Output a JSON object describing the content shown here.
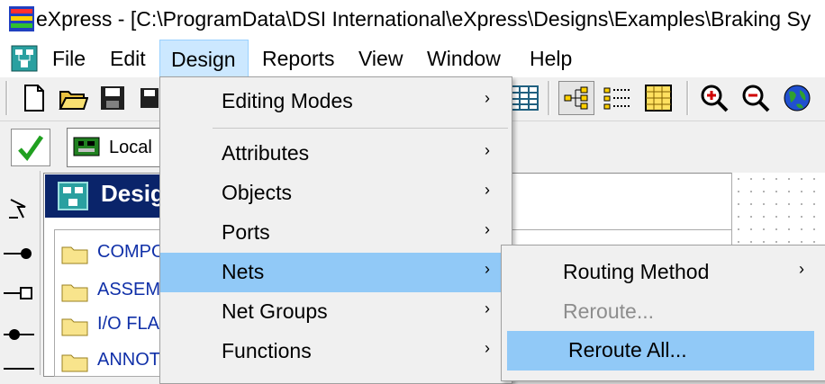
{
  "window": {
    "title": "eXpress - [C:\\ProgramData\\DSI International\\eXpress\\Designs\\Examples\\Braking Sy"
  },
  "menubar": {
    "items": [
      {
        "label": "File"
      },
      {
        "label": "Edit"
      },
      {
        "label": "Design"
      },
      {
        "label": "Reports"
      },
      {
        "label": "View"
      },
      {
        "label": "Window"
      },
      {
        "label": "Help"
      }
    ]
  },
  "toolbar2": {
    "combo_value": "Local"
  },
  "design_panel": {
    "header": "Desig",
    "tree": [
      {
        "label": "COMPO"
      },
      {
        "label": "ASSEM"
      },
      {
        "label": "I/O FLA"
      },
      {
        "label": "ANNOT"
      }
    ]
  },
  "design_menu": {
    "items": [
      {
        "label": "Editing Modes",
        "submenu": true
      },
      {
        "label": "Attributes",
        "submenu": true
      },
      {
        "label": "Objects",
        "submenu": true
      },
      {
        "label": "Ports",
        "submenu": true
      },
      {
        "label": "Nets",
        "submenu": true,
        "highlighted": true
      },
      {
        "label": "Net Groups",
        "submenu": true
      },
      {
        "label": "Functions",
        "submenu": true
      }
    ]
  },
  "nets_submenu": {
    "items": [
      {
        "label": "Routing Method",
        "submenu": true
      },
      {
        "label": "Reroute...",
        "disabled": true
      },
      {
        "label": "Reroute All...",
        "highlighted": true
      }
    ]
  },
  "colors": {
    "highlight": "#91c9f7",
    "menu_active": "#cce8ff",
    "panel_header": "#0a246a",
    "tree_text": "#1030a8"
  }
}
